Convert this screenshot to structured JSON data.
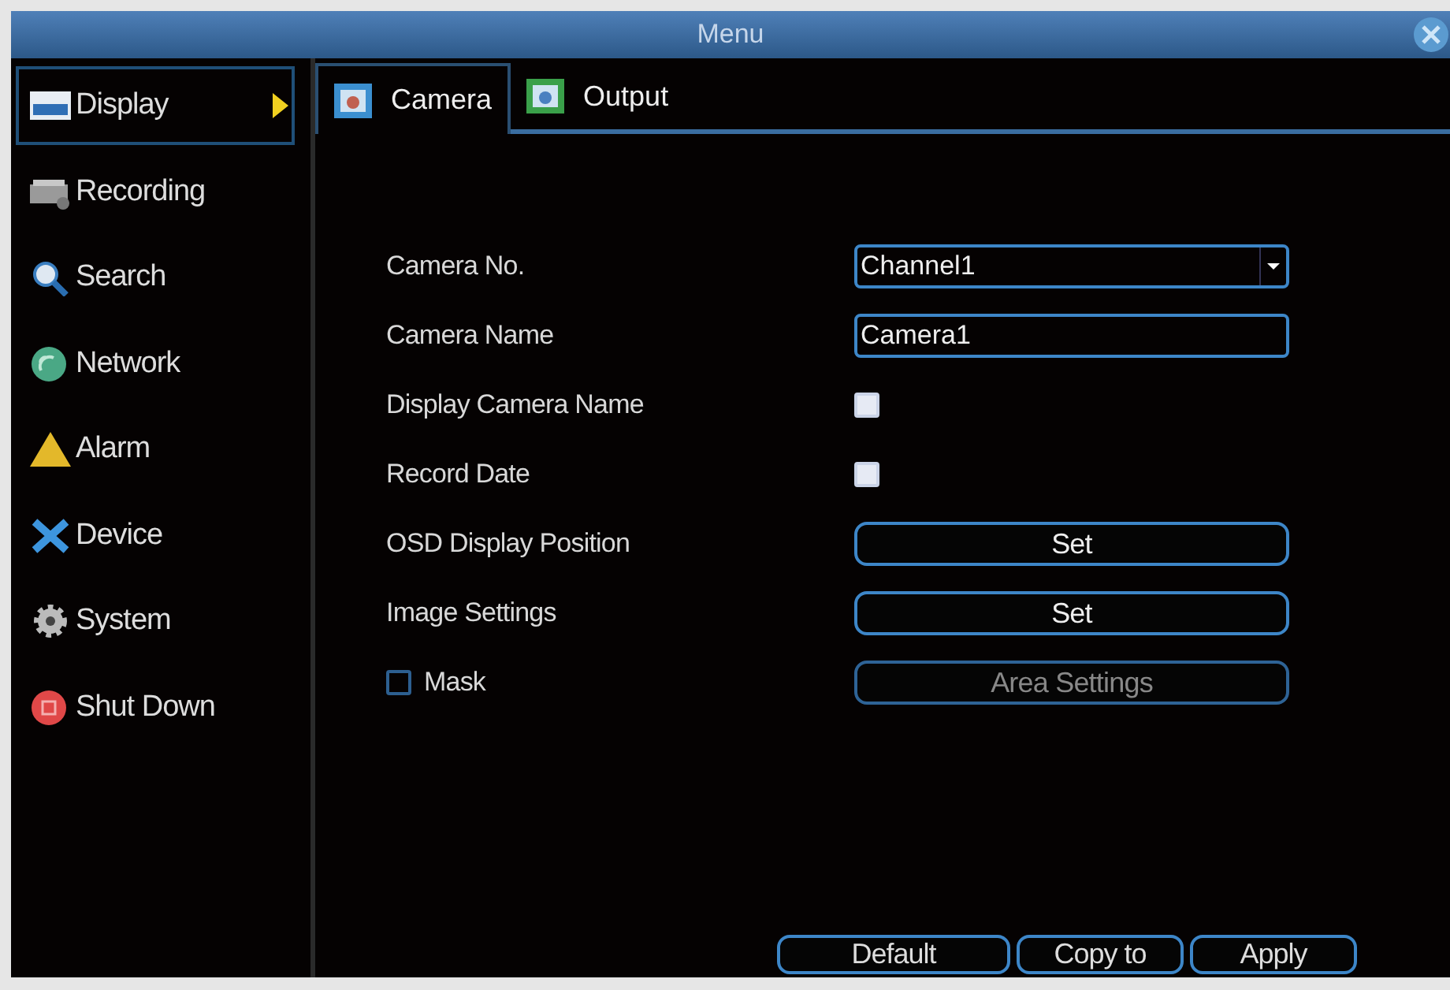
{
  "window": {
    "title": "Menu"
  },
  "sidebar": {
    "items": [
      {
        "label": "Display",
        "kind": "display",
        "selected": true
      },
      {
        "label": "Recording",
        "kind": "recording",
        "selected": false
      },
      {
        "label": "Search",
        "kind": "search",
        "selected": false
      },
      {
        "label": "Network",
        "kind": "network",
        "selected": false
      },
      {
        "label": "Alarm",
        "kind": "alarm",
        "selected": false
      },
      {
        "label": "Device",
        "kind": "device",
        "selected": false
      },
      {
        "label": "System",
        "kind": "system",
        "selected": false
      },
      {
        "label": "Shut Down",
        "kind": "shutdown",
        "selected": false
      }
    ]
  },
  "tabs": [
    {
      "label": "Camera",
      "selected": true
    },
    {
      "label": "Output",
      "selected": false
    }
  ],
  "form": {
    "rows": [
      {
        "kind": "dropdown",
        "label": "Camera No.",
        "value": "Channel1"
      },
      {
        "kind": "text",
        "label": "Camera Name",
        "value": "Camera1"
      },
      {
        "kind": "checkbox",
        "label": "Display Camera Name",
        "checked": true
      },
      {
        "kind": "checkbox",
        "label": "Record Date",
        "checked": true
      },
      {
        "kind": "button",
        "label": "OSD Display Position",
        "button": "Set",
        "disabled": false
      },
      {
        "kind": "button",
        "label": "Image Settings",
        "button": "Set",
        "disabled": false
      },
      {
        "kind": "check-button",
        "label": "Mask",
        "checked": false,
        "button": "Area Settings",
        "disabled": true
      }
    ]
  },
  "buttons": [
    "Default",
    "Copy to",
    "Apply"
  ]
}
